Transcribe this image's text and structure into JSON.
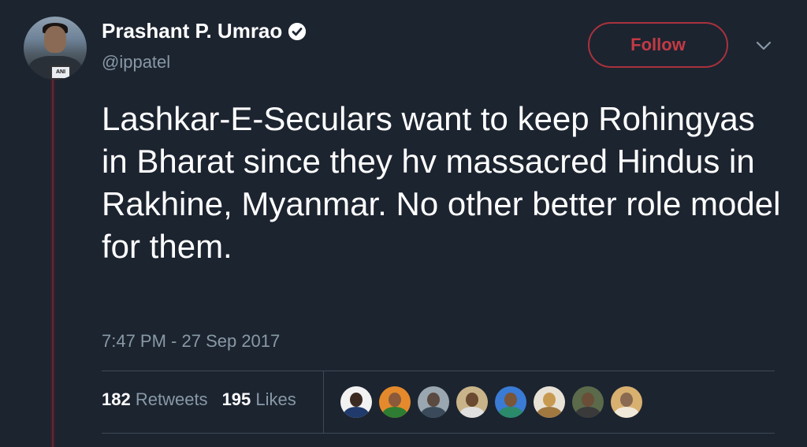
{
  "user": {
    "name": "Prashant P. Umrao",
    "handle": "@ippatel",
    "avatar_badge": "ANI",
    "verified_icon": "verified-badge-icon"
  },
  "actions": {
    "follow_label": "Follow",
    "menu_icon": "chevron-down-icon"
  },
  "tweet": {
    "text": "Lashkar-E-Seculars want to keep Rohingyas in Bharat since they hv massacred Hindus in Rakhine, Myanmar. No other better role model for them.",
    "timestamp": "7:47 PM - 27 Sep 2017"
  },
  "stats": {
    "retweets_count": "182",
    "retweets_label": "Retweets",
    "likes_count": "195",
    "likes_label": "Likes"
  },
  "colors": {
    "background": "#1c2430",
    "follow_accent": "#c33a44",
    "muted_text": "#8899a6"
  },
  "likers": [
    {
      "bg": "#f2f2f2",
      "face": "#3b2a22",
      "body": "#1f3a6b"
    },
    {
      "bg": "#e58a2c",
      "face": "#8a5a3a",
      "body": "#2e7d32"
    },
    {
      "bg": "#9aa6b0",
      "face": "#5b4a40",
      "body": "#3a4a5a"
    },
    {
      "bg": "#c9b48a",
      "face": "#6a4a30",
      "body": "#e0e0e0"
    },
    {
      "bg": "#3a7bd5",
      "face": "#7a5538",
      "body": "#2b8a6a"
    },
    {
      "bg": "#e8e2d6",
      "face": "#c89a50",
      "body": "#a07840"
    },
    {
      "bg": "#5b6a4a",
      "face": "#6a4e38",
      "body": "#3a3a3a"
    },
    {
      "bg": "#d8b070",
      "face": "#8a6a50",
      "body": "#f0e8d8"
    }
  ]
}
